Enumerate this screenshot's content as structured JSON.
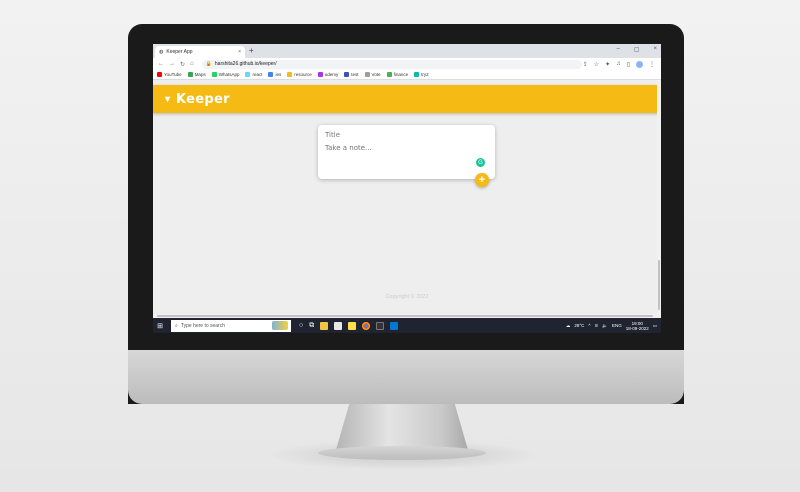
{
  "browser": {
    "tab_title": "Keeper App",
    "tab_close": "×",
    "new_tab": "+",
    "window_controls": [
      "–",
      "▢",
      "×"
    ],
    "url": "harshita26.github.io/keeper/",
    "bookmarks": [
      {
        "label": "YouTube",
        "color": "#ff0000"
      },
      {
        "label": "Maps",
        "color": "#34a853"
      },
      {
        "label": "WhatsApp",
        "color": "#25d366"
      },
      {
        "label": "react",
        "color": "#61dafb"
      },
      {
        "label": "ies",
        "color": "#4285f4"
      },
      {
        "label": "resource",
        "color": "#f5ba13"
      },
      {
        "label": "udemy",
        "color": "#a435f0"
      },
      {
        "label": "test",
        "color": "#3f51b5"
      },
      {
        "label": "Vote",
        "color": "#9e9e9e"
      },
      {
        "label": "finance",
        "color": "#4caf50"
      },
      {
        "label": "try2",
        "color": "#00bfa5"
      }
    ]
  },
  "app": {
    "title": "Keeper",
    "accent_color": "#f5ba13",
    "note_form": {
      "title_placeholder": "Title",
      "content_placeholder": "Take a note..."
    },
    "add_button_label": "+",
    "footer": "Copyright © 2022"
  },
  "taskbar": {
    "search_placeholder": "Type here to search",
    "weather": "28°C",
    "language": "ENG",
    "time": "19:00",
    "date": "18-09-2022"
  }
}
